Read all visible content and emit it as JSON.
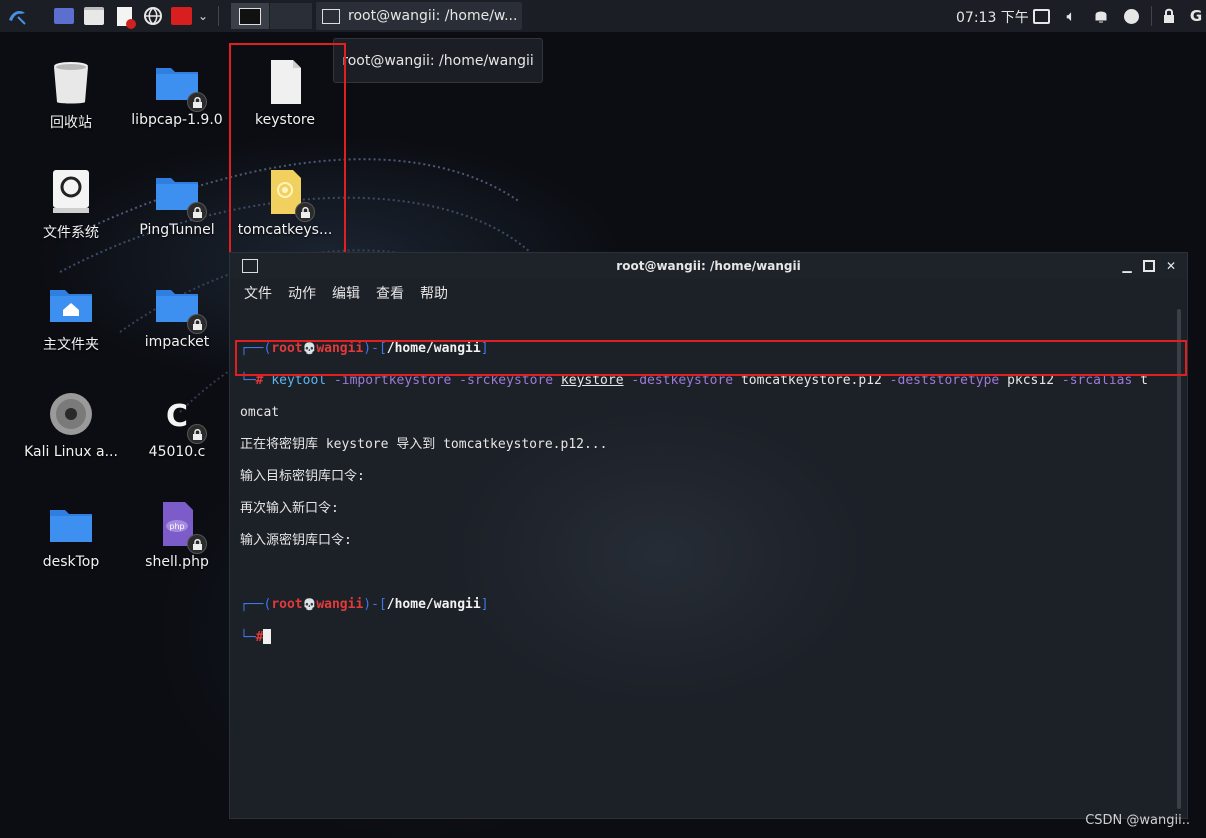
{
  "panel": {
    "task_title": "root@wangii: /home/w...",
    "clock": "07:13 下午"
  },
  "tooltip": "root@wangii: /home/wangii",
  "desktop_icons": [
    {
      "label": "回收站",
      "icon": "trash-icon"
    },
    {
      "label": "libpcap-1.9.0",
      "icon": "folder-icon"
    },
    {
      "label": "keystore",
      "icon": "file-icon"
    },
    {
      "label": "文件系统",
      "icon": "drive-icon"
    },
    {
      "label": "PingTunnel",
      "icon": "folder-icon"
    },
    {
      "label": "tomcatkeys...",
      "icon": "certificate-icon"
    },
    {
      "label": "主文件夹",
      "icon": "home-folder-icon"
    },
    {
      "label": "impacket",
      "icon": "folder-icon"
    },
    {
      "label": "Kali Linux a...",
      "icon": "disc-icon"
    },
    {
      "label": "45010.c",
      "icon": "c-file-icon"
    },
    {
      "label": "deskTop",
      "icon": "folder-icon"
    },
    {
      "label": "shell.php",
      "icon": "php-file-icon"
    }
  ],
  "terminal": {
    "title": "root@wangii: /home/wangii",
    "menu": [
      "文件",
      "动作",
      "编辑",
      "查看",
      "帮助"
    ],
    "prompt_user": "root",
    "prompt_skull": "💀",
    "prompt_host": "wangii",
    "prompt_dir": "/home/wangii",
    "prompt_hash": "#",
    "cmd_name": "keytool",
    "opt1": "-importkeystore",
    "opt2": "-srckeystore",
    "arg_src": "keystore",
    "opt3": "-destkeystore",
    "arg_dest": "tomcatkeystore.p12",
    "opt4": "-deststoretype",
    "arg_type": "pkcs12",
    "opt5": "-srcalias",
    "arg_alias_a": "t",
    "arg_alias_b": "omcat",
    "output": [
      "正在将密钥库 keystore 导入到 tomcatkeystore.p12...",
      "输入目标密钥库口令:",
      "再次输入新口令:",
      "输入源密钥库口令:"
    ]
  },
  "watermark": "CSDN @wangii.."
}
